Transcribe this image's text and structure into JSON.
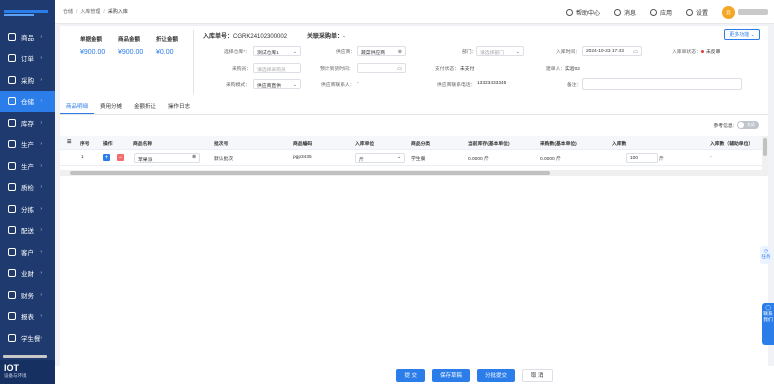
{
  "sidebar": {
    "brand": "IOT",
    "brand_sub": "设备与环境",
    "items": [
      {
        "label": "商品"
      },
      {
        "label": "订单"
      },
      {
        "label": "采购"
      },
      {
        "label": "仓储"
      },
      {
        "label": "库存"
      },
      {
        "label": "生产"
      },
      {
        "label": "生产"
      },
      {
        "label": "质检"
      },
      {
        "label": "分拣"
      },
      {
        "label": "配送"
      },
      {
        "label": "客户"
      },
      {
        "label": "业财"
      },
      {
        "label": "财务"
      },
      {
        "label": "报表"
      },
      {
        "label": "学生餐"
      }
    ],
    "active_index": 3
  },
  "breadcrumb": [
    "仓储",
    "入库管理",
    "采购入库"
  ],
  "header": {
    "help": "帮助中心",
    "messages": "消息",
    "apps": "应用",
    "settings": "设置",
    "avatar_text": "云"
  },
  "summary": {
    "doc_amount_label": "单据金额",
    "doc_amount": "¥900.00",
    "goods_amount_label": "商品金额",
    "goods_amount": "¥900.00",
    "discount_label": "折让金额",
    "discount": "¥0.00"
  },
  "order": {
    "no_label": "入库单号：",
    "no": "CGRK24102300002",
    "ref_label": "关联采购单：",
    "ref": "-",
    "more_btn": "更多功能"
  },
  "form": {
    "warehouse_label": "选择仓库*：",
    "warehouse": "测试仓库1",
    "supplier_label": "供应商：",
    "supplier": "蔬菜供应商",
    "dept_label": "部门：",
    "dept_placeholder": "请选择部门",
    "time_label": "入库时间：",
    "time": "2024-10-23 17:43",
    "status_label": "入库单状态：",
    "status": "未反审",
    "buyer_label": "采购员：",
    "buyer_placeholder": "请选择采购员",
    "expect_label": "预计到货时间：",
    "pay_label": "支付状态：",
    "pay": "未支付",
    "creator_label": "建单人：",
    "creator": "实验02",
    "mode_label": "采购模式：",
    "mode": "供应商直供",
    "contact_label": "供应商联系人：",
    "contact": "-",
    "phone_label": "供应商联系电话：",
    "phone": "13323433345",
    "remark_label": "备注："
  },
  "tabs": [
    "商品明细",
    "费用分摊",
    "金额折让",
    "操作日志"
  ],
  "toggle": {
    "label": "参考信息:",
    "state": "关闭"
  },
  "table": {
    "headers": [
      "序号",
      "操作",
      "商品名称",
      "批次号",
      "商品编码",
      "入库单位",
      "商品分类",
      "当前库存(基本单位)",
      "采购数(基本单位)",
      "入库数",
      "入库数（辅助单位）"
    ],
    "rows": [
      {
        "seq": "1",
        "name": "苹果派",
        "batch": "默认批次",
        "code": "pgp3435",
        "unit": "斤",
        "category": "学生餐",
        "stock": "0.0000 斤",
        "purchase": "0.0000 斤",
        "qty": "100",
        "qty_unit": "斤",
        "aux": "-"
      }
    ]
  },
  "footer": {
    "submit": "提 交",
    "save_draft": "保存草稿",
    "batch_submit": "分批提交",
    "cancel": "取 消"
  },
  "float": {
    "task": "任务",
    "contact": "联系我们"
  },
  "colors": {
    "primary": "#2b7de9",
    "sidebar": "#1e3a6e",
    "danger": "#f56c6c"
  }
}
